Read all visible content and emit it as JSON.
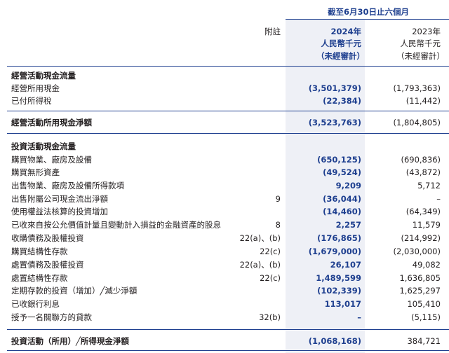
{
  "header": {
    "period": "截至6月30日止六個月",
    "note_col": "附註",
    "y2024": {
      "year": "2024年",
      "unit": "人民幣千元",
      "status": "（未經審計）"
    },
    "y2023": {
      "year": "2023年",
      "unit": "人民幣千元",
      "status": "（未經審計）"
    }
  },
  "operating": {
    "title": "經營活動現金流量",
    "rows": [
      {
        "label": "經營所用現金",
        "note": "",
        "v2024": "(3,501,379)",
        "v2023": "(1,793,363)"
      },
      {
        "label": "已付所得稅",
        "note": "",
        "v2024": "(22,384)",
        "v2023": "(11,442)"
      }
    ],
    "total": {
      "label": "經營活動所用現金淨額",
      "v2024": "(3,523,763)",
      "v2023": "(1,804,805)"
    }
  },
  "investing": {
    "title": "投資活動現金流量",
    "rows": [
      {
        "label": "購買物業、廠房及設備",
        "note": "",
        "v2024": "(650,125)",
        "v2023": "(690,836)"
      },
      {
        "label": "購買無形資產",
        "note": "",
        "v2024": "(49,524)",
        "v2023": "(43,872)"
      },
      {
        "label": "出售物業、廠房及設備所得款項",
        "note": "",
        "v2024": "9,209",
        "v2023": "5,712"
      },
      {
        "label": "出售附屬公司現金流出淨額",
        "note": "9",
        "v2024": "(36,044)",
        "v2023": "–"
      },
      {
        "label": "使用權益法核算的投資增加",
        "note": "",
        "v2024": "(14,460)",
        "v2023": "(64,349)"
      },
      {
        "label": "已收來自按公允價值計量且變動計入損益的金融資產的股息",
        "note": "8",
        "v2024": "2,257",
        "v2023": "11,579"
      },
      {
        "label": "收購債務及股權投資",
        "note": "22(a)、(b)",
        "v2024": "(176,865)",
        "v2023": "(214,992)"
      },
      {
        "label": "購買結構性存款",
        "note": "22(c)",
        "v2024": "(1,679,000)",
        "v2023": "(2,030,000)"
      },
      {
        "label": "處置債務及股權投資",
        "note": "22(a)、(b)",
        "v2024": "26,107",
        "v2023": "49,082"
      },
      {
        "label": "處置結構性存款",
        "note": "22(c)",
        "v2024": "1,489,599",
        "v2023": "1,636,805"
      },
      {
        "label": "定期存款的投資（增加）╱減少淨額",
        "note": "",
        "v2024": "(102,339)",
        "v2023": "1,625,297"
      },
      {
        "label": "已收銀行利息",
        "note": "",
        "v2024": "113,017",
        "v2023": "105,410"
      },
      {
        "label": "授予一名關聯方的貸款",
        "note": "32(b)",
        "v2024": "–",
        "v2023": "(5,115)"
      }
    ],
    "total": {
      "label": "投資活動（所用）╱所得現金淨額",
      "v2024": "(1,068,168)",
      "v2023": "384,721"
    }
  }
}
